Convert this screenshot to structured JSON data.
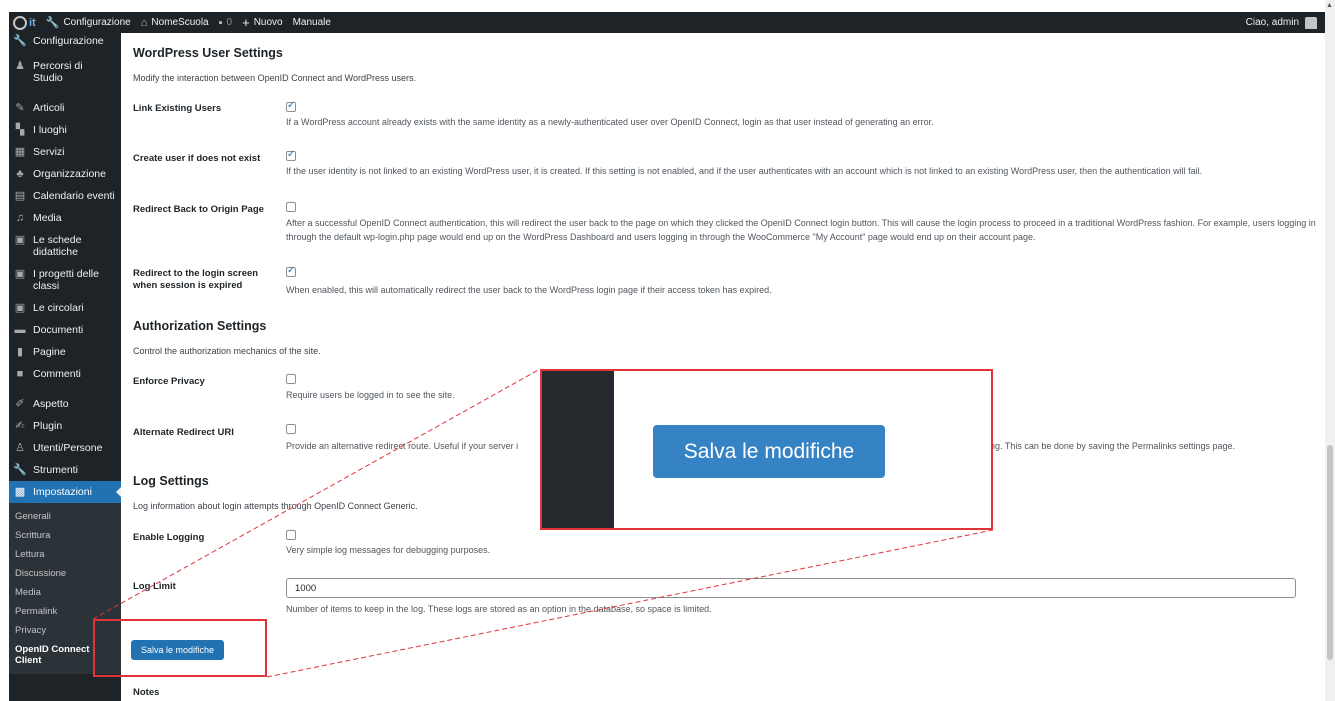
{
  "topbar": {
    "logo": "it",
    "items": [
      "Configurazione",
      "NomeScuola",
      "0",
      "Nuovo",
      "Manuale"
    ],
    "greeting": "Ciao, admin"
  },
  "sidebar": {
    "top_items": [
      {
        "label": "Configurazione",
        "icon": "wrench-icon"
      },
      {
        "label": "Percorsi di Studio",
        "icon": "student-icon"
      }
    ],
    "items": [
      {
        "label": "Articoli",
        "icon": "pin-icon"
      },
      {
        "label": "I luoghi",
        "icon": "place-icon"
      },
      {
        "label": "Servizi",
        "icon": "services-icon"
      },
      {
        "label": "Organizzazione",
        "icon": "organization-icon"
      },
      {
        "label": "Calendario eventi",
        "icon": "calendar-icon"
      },
      {
        "label": "Media",
        "icon": "media-icon"
      },
      {
        "label": "Le schede didattiche",
        "icon": "document-icon"
      },
      {
        "label": "I progetti delle classi",
        "icon": "document-icon"
      },
      {
        "label": "Le circolari",
        "icon": "document-icon"
      },
      {
        "label": "Documenti",
        "icon": "folder-icon"
      },
      {
        "label": "Pagine",
        "icon": "page-icon"
      },
      {
        "label": "Commenti",
        "icon": "comment-icon"
      }
    ],
    "items2": [
      {
        "label": "Aspetto",
        "icon": "brush-icon"
      },
      {
        "label": "Plugin",
        "icon": "plugin-icon"
      },
      {
        "label": "Utenti/Persone",
        "icon": "users-icon"
      },
      {
        "label": "Strumenti",
        "icon": "tools-icon"
      },
      {
        "label": "Impostazioni",
        "icon": "settings-icon"
      }
    ],
    "submenu": [
      "Generali",
      "Scrittura",
      "Lettura",
      "Discussione",
      "Media",
      "Permalink",
      "Privacy",
      "OpenID Connect Client"
    ]
  },
  "content": {
    "wp_user_settings": {
      "title": "WordPress User Settings",
      "description": "Modify the interaction between OpenID Connect and WordPress users.",
      "rows": [
        {
          "label": "Link Existing Users",
          "checked": true,
          "desc": "If a WordPress account already exists with the same identity as a newly-authenticated user over OpenID Connect, login as that user instead of generating an error."
        },
        {
          "label": "Create user if does not exist",
          "checked": true,
          "desc": "If the user identity is not linked to an existing WordPress user, it is created. If this setting is not enabled, and if the user authenticates with an account which is not linked to an existing WordPress user, then the authentication will fail."
        },
        {
          "label": "Redirect Back to Origin Page",
          "checked": false,
          "desc": "After a successful OpenID Connect authentication, this will redirect the user back to the page on which they clicked the OpenID Connect login button. This will cause the login process to proceed in a traditional WordPress fashion. For example, users logging in through the default wp-login.php page would end up on the WordPress Dashboard and users logging in through the WooCommerce \"My Account\" page would end up on their account page."
        },
        {
          "label": "Redirect to the login screen when session is expired",
          "checked": true,
          "desc": "When enabled, this will automatically redirect the user back to the WordPress login page if their access token has expired."
        }
      ]
    },
    "authorization_settings": {
      "title": "Authorization Settings",
      "description": "Control the authorization mechanics of the site.",
      "rows": [
        {
          "label": "Enforce Privacy",
          "checked": false,
          "desc": "Require users be logged in to see the site."
        },
        {
          "label": "Alternate Redirect URI",
          "checked": false,
          "desc_left": "Provide an alternative redirect route. Useful if your server i",
          "desc_right": "ing. This can be done by saving the Permalinks settings page."
        }
      ]
    },
    "log_settings": {
      "title": "Log Settings",
      "description": "Log information about login attempts through OpenID Connect Generic.",
      "enable_logging": {
        "label": "Enable Logging",
        "checked": false,
        "desc": "Very simple log messages for debugging purposes."
      },
      "log_limit": {
        "label": "Log Limit",
        "value": "1000",
        "desc": "Number of items to keep in the log. These logs are stored as an option in the database, so space is limited."
      }
    },
    "save_label": "Salva le modifiche",
    "notes_title": "Notes"
  },
  "zoom": {
    "save_label": "Salva le modifiche",
    "accent": "#e0343a"
  },
  "colors": {
    "adminbar": "#1d2327",
    "primary": "#2271b1"
  }
}
